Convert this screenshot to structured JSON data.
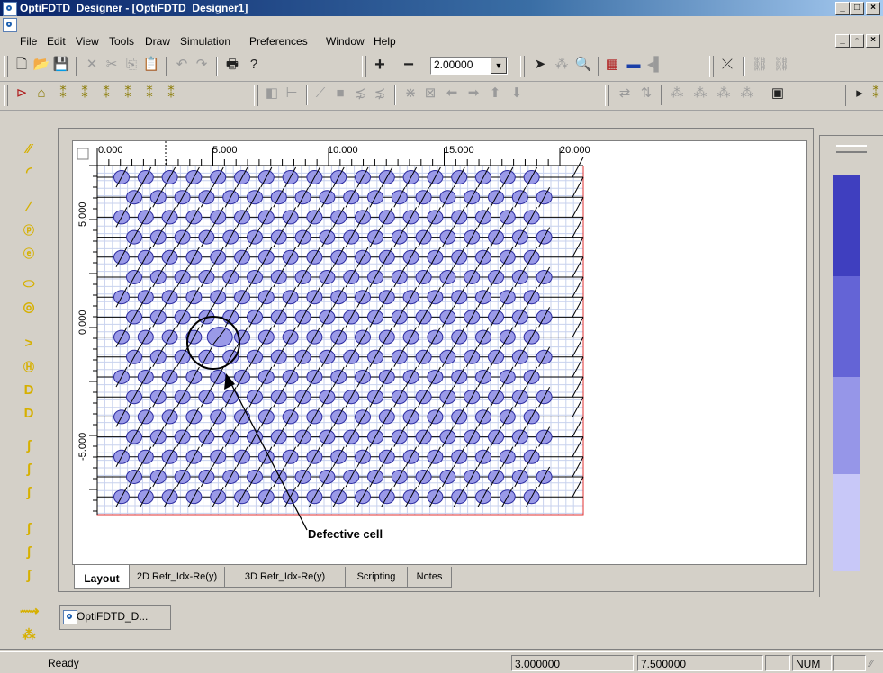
{
  "window": {
    "title": "OptiFDTD_Designer - [OptiFDTD_Designer1]"
  },
  "menu": [
    "File",
    "Edit",
    "View",
    "Tools",
    "Draw",
    "Simulation",
    "Preferences",
    "Window",
    "Help"
  ],
  "toolbar": {
    "zoom_value": "2.00000"
  },
  "ruler": {
    "x_labels": [
      "0.000",
      "5.000",
      "10.000",
      "15.000",
      "20.000"
    ],
    "y_labels": [
      "5.000",
      "0.000",
      "-5.000"
    ]
  },
  "annotation": {
    "label": "Defective cell"
  },
  "tabs": [
    "Layout",
    "2D Refr_Idx-Re(y)",
    "3D Refr_Idx-Re(y)",
    "Scripting",
    "Notes"
  ],
  "document_tab": {
    "label": "OptiFDTD_D..."
  },
  "status": {
    "text": "Ready",
    "x_coord": "3.000000",
    "y_coord": "7.500000",
    "num": "NUM"
  },
  "colors": {
    "lattice_fill": "#9a9ae8",
    "lattice_stroke": "#2a2aa0",
    "accent": "#0a246a"
  }
}
